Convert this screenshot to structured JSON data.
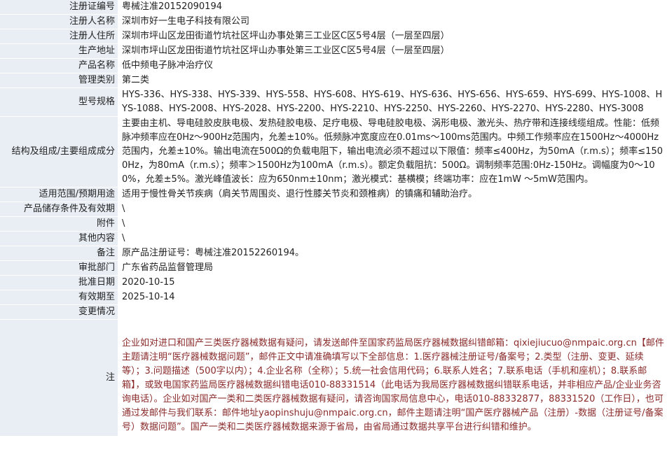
{
  "colors": {
    "label_bg": "#e8eef4",
    "value_bg": "#ffffff",
    "note_text": "#8a2a2a"
  },
  "rows": [
    {
      "label": "注册证编号",
      "value": "粤械注准20152090194"
    },
    {
      "label": "注册人名称",
      "value": "深圳市好一生电子科技有限公司"
    },
    {
      "label": "注册人住所",
      "value": "深圳市坪山区龙田街道竹坑社区坪山办事处第三工业区C区5号4层（一层至四层）"
    },
    {
      "label": "生产地址",
      "value": "深圳市坪山区龙田街道竹坑社区坪山办事处第三工业区C区5号4层（一层至四层）"
    },
    {
      "label": "产品名称",
      "value": "低中频电子脉冲治疗仪"
    },
    {
      "label": "管理类别",
      "value": "第二类"
    },
    {
      "label": "型号规格",
      "value": "HYS-336、HYS-338、HYS-339、HYS-558、HYS-608、HYS-619、HYS-636、HYS-656、HYS-659、HYS-699、HYS-1008、HYS-1088、HYS-2008、HYS-2028、HYS-2200、HYS-2210、HYS-2250、HYS-2260、HYS-2270、HYS-2280、HYS-3008"
    },
    {
      "label": "结构及组成/主要组成成分",
      "value": "主要由主机、导电硅胶皮肤电极、发热硅胶电极、足疗电极、导电硅胶电极、涡形电极、激光头、热疗带和连接线缆组成。性能：低频脉冲频率应在0Hz～900Hz范围内，允差±10%。低频脉冲宽度应在0.01ms～100ms范围内。中频工作频率应在1500Hz～4000Hz范围内，允差±10%。输出电流在500Ω的负载电阻下，输出电流必须不超过以下限值：频率≤400Hz，为50mA（r.m.s）；频率≤1500Hz，为80mA（r.m.s）；频率＞1500Hz为100mA（r.m.s）。额定负载阻抗：500Ω。调制频率范围:0Hz-150Hz。调幅度为0～100%，允差±5%。激光峰值波长：应为650nm±10nm；激光模式：基横模；终端功率：应在1mW ～5mW范围内。"
    },
    {
      "label": "适用范围/预期用途",
      "value": "适用于慢性骨关节疾病（肩关节周围炎、退行性膝关节炎和颈椎病）的镇痛和辅助治疗。"
    },
    {
      "label": "产品储存条件及有效期",
      "value": "\\"
    },
    {
      "label": "附件",
      "value": "\\"
    },
    {
      "label": "其他内容",
      "value": "\\"
    },
    {
      "label": "备注",
      "value": "原产品注册证号：粤械注准20152260194。"
    },
    {
      "label": "审批部门",
      "value": "广东省药品监督管理局"
    },
    {
      "label": "批准日期",
      "value": "2020-10-15"
    },
    {
      "label": "有效期至",
      "value": "2025-10-14"
    },
    {
      "label": "变更情况",
      "value": ""
    }
  ],
  "note": {
    "label": "注",
    "text": "企业如对进口和国产三类医疗器械数据有疑问，请发送邮件至国家药监局医疗器械数据纠错邮箱：qixiejiucuo@nmpaic.org.cn【邮件主题请注明“医疗器械数据问题”，邮件正文中请准确填写以下全部信息：1.医疗器械注册证号/备案号；2.类型（注册、变更、延续等）；3.问题描述（500字以内）；4.企业名称（全称）；5.统一社会信用代码；6.联系人姓名；7.联系电话（手机和座机）；8.联系邮箱】，或致电国家药监局医疗器械数据纠错电话010-88331514（此电话为我局医疗器械数据纠错联系电话，并非相应产品/企业业务咨询电话）。企业如对国产一类和二类医疗器械数据有疑问，请咨询国家局信息中心，电话010-88332877，88331520（工作日），也可通过发邮件与我们联系：邮件地址yaopinshuju@nmpaic.org.cn，邮件主题请注明“国产医疗器械产品（注册）-数据（注册证号/备案号）数据问题”。国产一类和二类医疗器械数据来源于省局，由省局通过数据共享平台进行纠错和维护。"
  }
}
